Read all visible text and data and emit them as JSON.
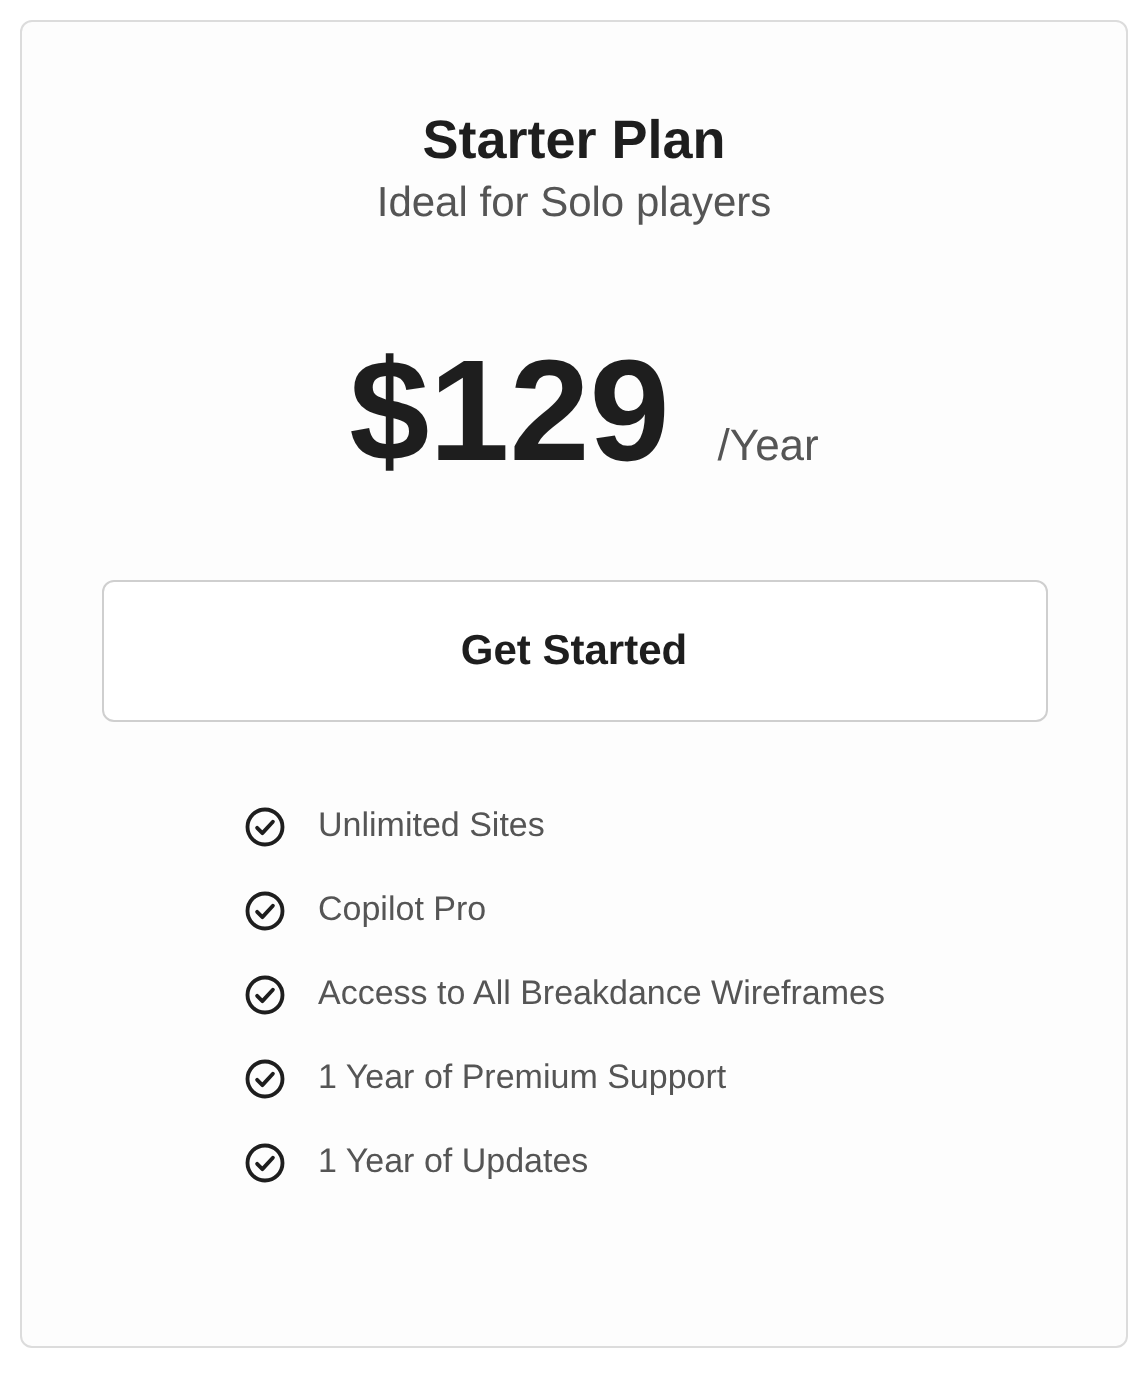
{
  "plan": {
    "title": "Starter Plan",
    "subtitle": "Ideal for Solo players",
    "price": "$129",
    "period": "/Year",
    "button": "Get Started",
    "features": [
      "Unlimited Sites",
      "Copilot Pro",
      "Access to All Breakdance Wireframes",
      "1 Year of Premium Support",
      "1 Year of Updates"
    ]
  }
}
